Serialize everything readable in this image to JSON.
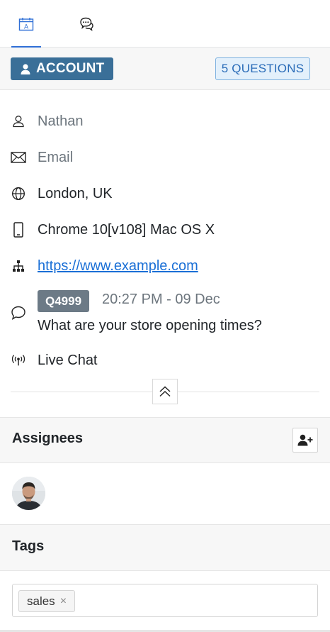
{
  "tabs": [
    {
      "label": "Details",
      "icon": "calendar-a-icon",
      "active": true
    },
    {
      "label": "Chat",
      "icon": "chat-bubbles-icon",
      "active": false
    }
  ],
  "account": {
    "button_label": "ACCOUNT",
    "questions_badge": "5 QUESTIONS"
  },
  "info": {
    "name": "Nathan",
    "email": "Email",
    "location": "London, UK",
    "browser": "Chrome 10[v108] Mac OS X",
    "website": "https://www.example.com",
    "channel": "Live Chat"
  },
  "ticket": {
    "id": "Q4999",
    "time": "20:27 PM - 09 Dec",
    "message": "What are your store opening times?"
  },
  "assignees": {
    "title": "Assignees"
  },
  "tags": {
    "title": "Tags",
    "items": [
      "sales"
    ],
    "remove_glyph": "×"
  },
  "colors": {
    "accent": "#2f6fd6",
    "account_button": "#3a6f98",
    "badge_bg": "#e3f0fb",
    "badge_text": "#2a6cb8",
    "ticket_badge": "#6c7a86",
    "link": "#1a6fd6"
  }
}
